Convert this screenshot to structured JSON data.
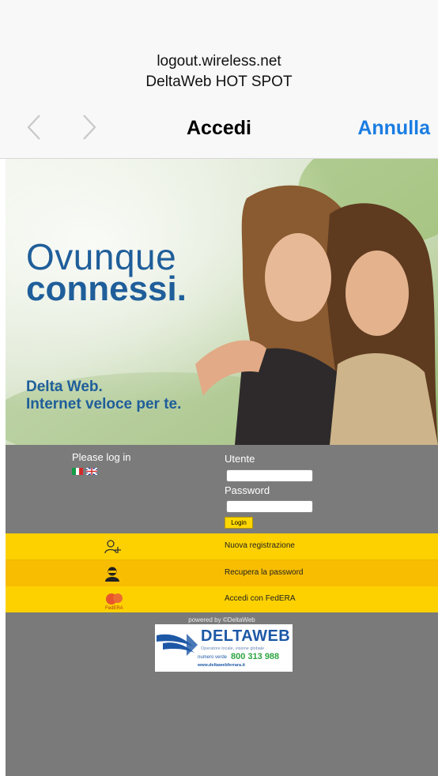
{
  "browser": {
    "url": "logout.wireless.net",
    "site_name": "DeltaWeb HOT SPOT",
    "title": "Accedi",
    "cancel_label": "Annulla",
    "back_icon": "chevron-left-icon",
    "forward_icon": "chevron-right-icon"
  },
  "hero": {
    "headline_line1": "Ovunque",
    "headline_line2": "connessi.",
    "tagline_line1": "Delta Web.",
    "tagline_line2": "Internet veloce per te."
  },
  "login": {
    "prompt": "Please log in",
    "languages": [
      "it-flag-icon",
      "uk-flag-icon"
    ],
    "user_label": "Utente",
    "user_value": "",
    "password_label": "Password",
    "password_value": "",
    "login_button": "Login"
  },
  "menu": [
    {
      "icon": "add-user-icon",
      "label": "Nuova registrazione"
    },
    {
      "icon": "user-silhouette-icon",
      "label": "Recupera la password"
    },
    {
      "icon": "federa-icon",
      "label": "Accedi con FedERA",
      "icon_text": "FedERA"
    }
  ],
  "footer": {
    "powered_by": "powered by ©DeltaWeb",
    "logo_name": "DELTAWEB",
    "logo_subtitle": "Operatore locale, visione globale",
    "phone_label": "numero verde",
    "phone_number": "800 313 988",
    "website": "www.deltawebferrara.it"
  },
  "colors": {
    "brand_blue": "#1f5e9a",
    "ios_blue": "#1a7de2",
    "yellow": "#fdd100",
    "yellow_dark": "#f8bd00",
    "gray_bg": "#7a7a7a"
  }
}
